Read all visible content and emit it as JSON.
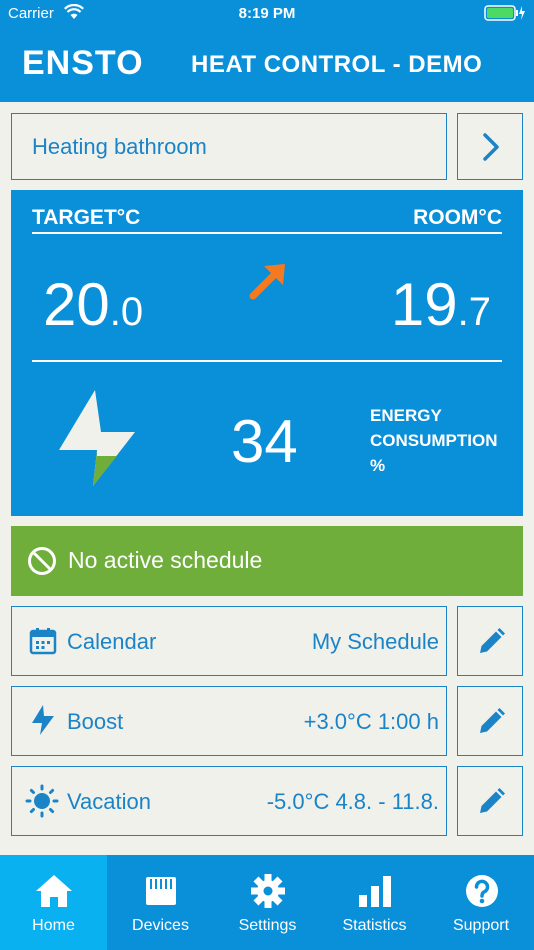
{
  "status": {
    "carrier": "Carrier",
    "time": "8:19 PM"
  },
  "header": {
    "logo": "ENSTO",
    "title": "HEAT CONTROL - DEMO"
  },
  "device": {
    "name": "Heating bathroom"
  },
  "climate": {
    "target_label": "TARGET°C",
    "room_label": "ROOM°C",
    "target_int": "20",
    "target_dec": ".0",
    "room_int": "19",
    "room_dec": ".7",
    "energy_value": "34",
    "energy_label_1": "ENERGY",
    "energy_label_2": "CONSUMPTION",
    "energy_label_3": "%"
  },
  "schedule_status": "No active schedule",
  "rows": [
    {
      "name": "Calendar",
      "value": "My Schedule",
      "icon": "calendar-icon"
    },
    {
      "name": "Boost",
      "value": "+3.0°C 1:00 h",
      "icon": "lightning-icon"
    },
    {
      "name": "Vacation",
      "value": "-5.0°C 4.8. - 11.8.",
      "icon": "sun-icon"
    }
  ],
  "tabs": [
    {
      "label": "Home",
      "icon": "home-icon",
      "active": true
    },
    {
      "label": "Devices",
      "icon": "device-icon"
    },
    {
      "label": "Settings",
      "icon": "gear-icon"
    },
    {
      "label": "Statistics",
      "icon": "bar-chart-icon"
    },
    {
      "label": "Support",
      "icon": "question-icon"
    }
  ],
  "colors": {
    "primary": "#0a8fd9",
    "active_tab": "#0ab1f1",
    "schedule": "#6fae3b",
    "arrow": "#f47a20",
    "text_blue": "#1b84c7"
  }
}
